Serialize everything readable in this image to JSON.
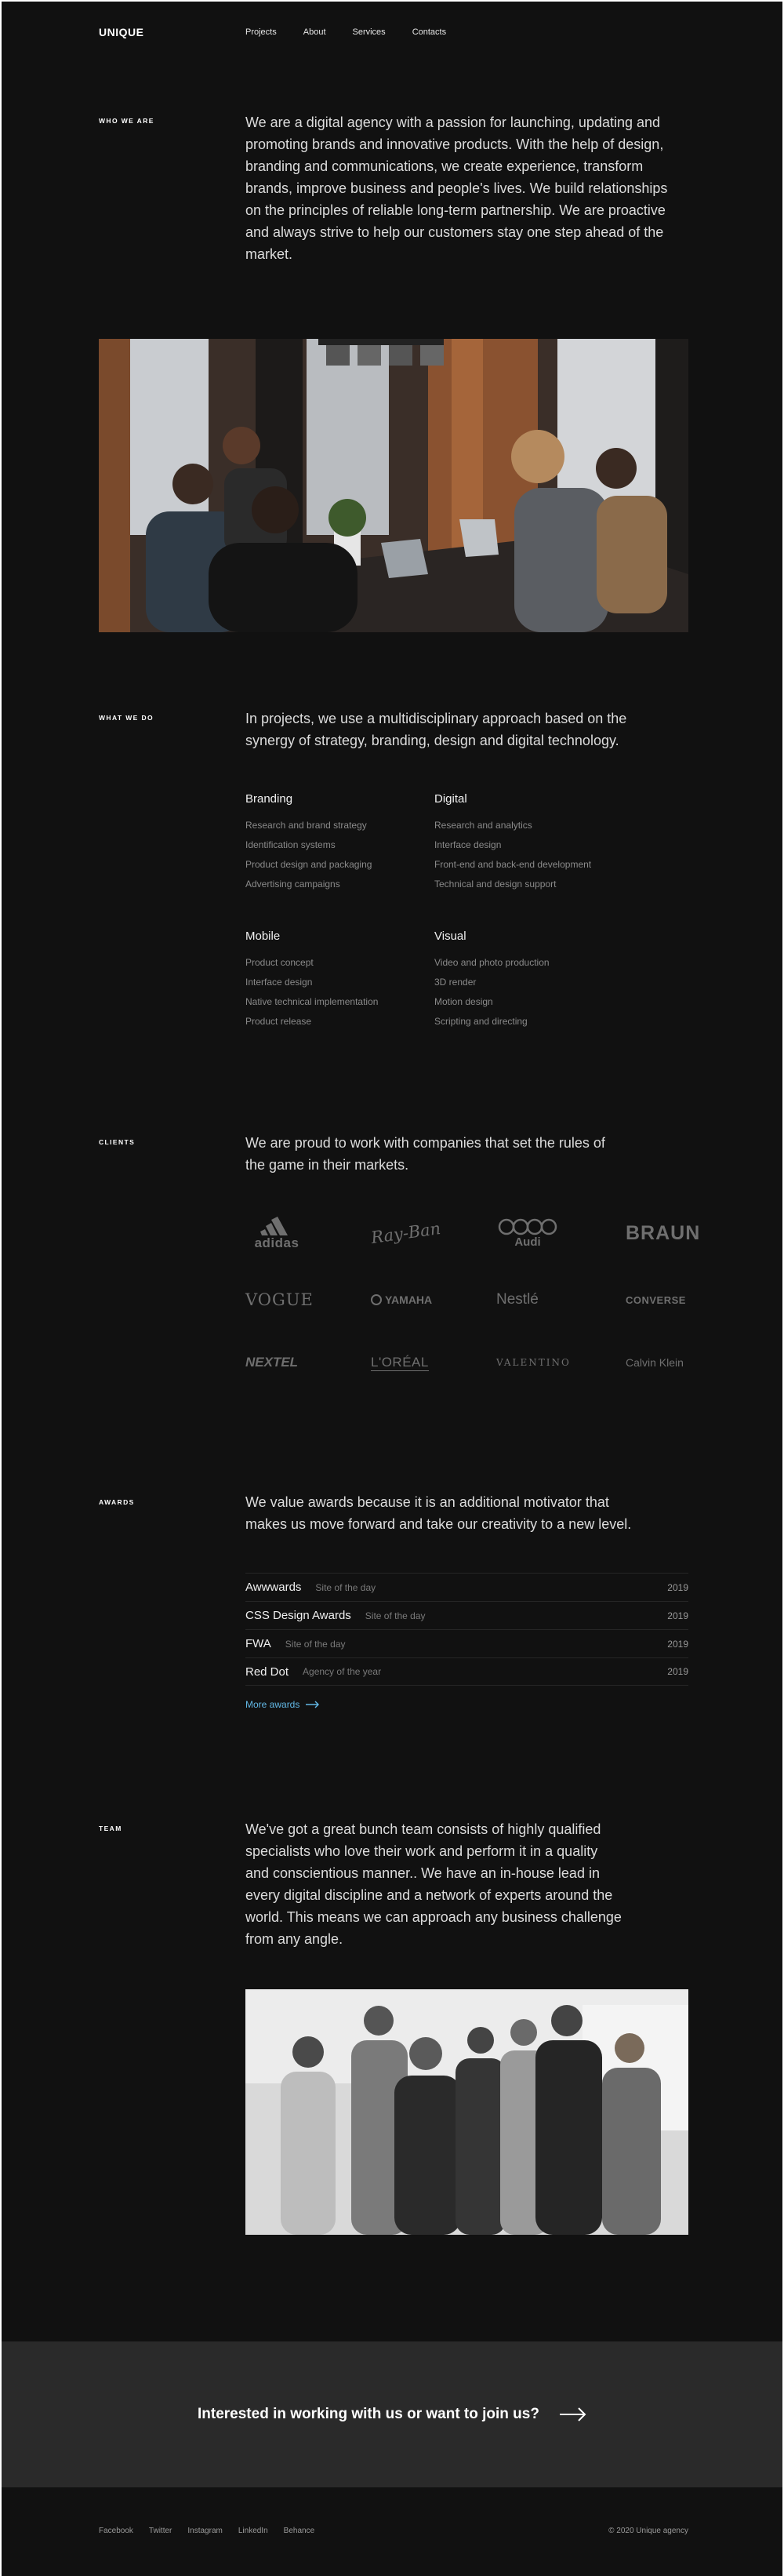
{
  "header": {
    "logo": "UNIQUE",
    "nav": [
      "Projects",
      "About",
      "Services",
      "Contacts"
    ]
  },
  "about": {
    "label": "WHO WE ARE",
    "text_lines": [
      "We are a digital agency with a passion for launching, updating and",
      "promoting brands and innovative products. With the help of design,",
      "branding and communications, we create experience, transform",
      "brands, improve business and people's lives. We build relationships",
      "on the principles of reliable long-term partnership. We are proactive",
      "and always strive to help our customers stay one step ahead of the",
      "market."
    ]
  },
  "services": {
    "label": "WHAT WE DO",
    "text_lines": [
      "In projects, we use a multidisciplinary approach based on the",
      "synergy of strategy, branding, design and digital technology."
    ],
    "groups": [
      {
        "title": "Branding",
        "items": [
          "Research and brand strategy",
          "Identification systems",
          "Product design and packaging",
          "Advertising campaigns"
        ]
      },
      {
        "title": "Digital",
        "items": [
          "Research and analytics",
          "Interface design",
          "Front-end and back-end development",
          "Technical and design support"
        ]
      },
      {
        "title": "Mobile",
        "items": [
          "Product concept",
          "Interface design",
          "Native technical implementation",
          "Product release"
        ]
      },
      {
        "title": "Visual",
        "items": [
          "Video and photo production",
          "3D render",
          "Motion design",
          "Scripting and directing"
        ]
      }
    ]
  },
  "clients": {
    "label": "CLIENTS",
    "text_lines": [
      "We are proud to work with companies that set the rules of",
      "the game in their markets."
    ],
    "logos": [
      "adidas",
      "Ray-Ban",
      "Audi",
      "BRAUN",
      "VOGUE",
      "YAMAHA",
      "Nestlé",
      "CONVERSE",
      "NEXTEL",
      "L'ORÉAL",
      "VALENTINO",
      "Calvin Klein"
    ]
  },
  "awards": {
    "label": "AWARDS",
    "text_lines": [
      "We value awards because it is an additional motivator that",
      "makes us move forward and take our creativity to a new level."
    ],
    "rows": [
      {
        "name": "Awwwards",
        "desc": "Site of the day",
        "year": "2019"
      },
      {
        "name": "CSS Design Awards",
        "desc": "Site of the day",
        "year": "2019"
      },
      {
        "name": "FWA",
        "desc": "Site of the day",
        "year": "2019"
      },
      {
        "name": "Red Dot",
        "desc": "Agency of the year",
        "year": "2019"
      }
    ],
    "more_label": "More awards",
    "accent": "#62b8e6"
  },
  "team": {
    "label": "TEAM",
    "text_lines": [
      "We've got a great bunch team consists of highly qualified",
      "specialists who love their work and perform it in a quality",
      "and conscientious manner.. We have an in-house lead in",
      "every digital discipline and a network of experts around the",
      "world. This means we can approach any business challenge",
      "from any angle."
    ]
  },
  "cta": {
    "text": "Interested in working with us or want to join us?",
    "background": "#2a2a2a"
  },
  "footer": {
    "links": [
      "Facebook",
      "Twitter",
      "Instagram",
      "LinkedIn",
      "Behance"
    ],
    "copyright": "© 2020 Unique agency"
  }
}
